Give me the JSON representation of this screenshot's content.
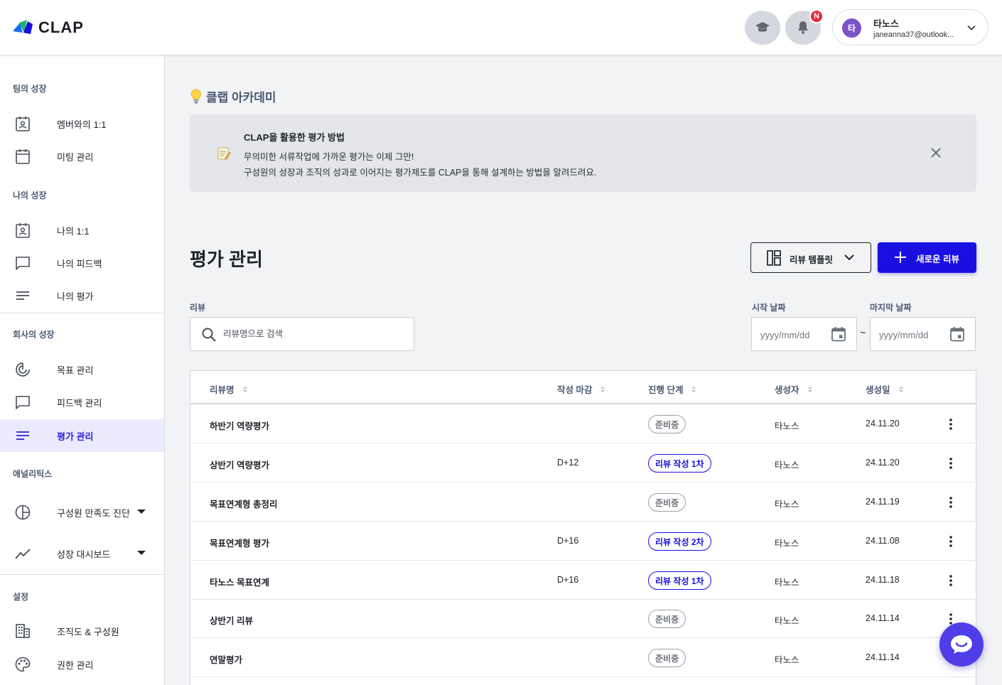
{
  "app": {
    "logo_text": "CLAP",
    "brand_color": "#1a0fe3"
  },
  "header": {
    "academy_icon": "graduation-cap-icon",
    "notification_badge": "N",
    "user": {
      "avatar_initial": "타",
      "name": "타노스",
      "email": "janeanna37@outlook..."
    }
  },
  "sidebar": {
    "sections": [
      {
        "title": "팀의 성장",
        "items": [
          {
            "label": "멤버와의 1:1",
            "icon": "contact-calendar-icon"
          },
          {
            "label": "미팅 관리",
            "icon": "calendar-icon"
          }
        ]
      },
      {
        "title": "나의 성장",
        "items": [
          {
            "label": "나의 1:1",
            "icon": "contact-calendar-icon"
          },
          {
            "label": "나의 피드백",
            "icon": "chat-bubble-icon"
          },
          {
            "label": "나의 평가",
            "icon": "lines-icon"
          }
        ]
      },
      {
        "title": "회사의 성장",
        "items": [
          {
            "label": "목표 관리",
            "icon": "target-icon"
          },
          {
            "label": "피드백 관리",
            "icon": "chat-bubble-icon"
          },
          {
            "label": "평가 관리",
            "icon": "lines-icon",
            "active": true
          }
        ]
      },
      {
        "title": "애널리틱스",
        "items": [
          {
            "label": "구성원 만족도 진단",
            "icon": "pie-chart-icon"
          },
          {
            "label": "성장 대시보드",
            "icon": "trend-line-icon"
          }
        ]
      },
      {
        "title": "설정",
        "items": [
          {
            "label": "조직도 & 구성원",
            "icon": "building-icon"
          },
          {
            "label": "권한 관리",
            "icon": "palette-icon"
          }
        ]
      }
    ]
  },
  "academy": {
    "title": "클랩 아카데미",
    "banner": {
      "title": "CLAP을 활용한 평가 방법",
      "line1": "무의미한 서류작업에 가까운 평가는 이제 그만!",
      "line2": "구성원의 성장과 조직의 성과로 이어지는 평가제도를 CLAP을 통해 설계하는 방법을 알려드려요."
    }
  },
  "main": {
    "title": "평가 관리",
    "template_button": "리뷰 템플릿",
    "new_button": "새로운 리뷰",
    "filters": {
      "review_label": "리뷰",
      "search_placeholder": "리뷰명으로 검색",
      "start_label": "시작 날짜",
      "end_label": "마지막 날짜",
      "date_placeholder": "yyyy/mm/dd",
      "separator": "~"
    },
    "table": {
      "headers": {
        "name": "리뷰명",
        "due": "작성 마감",
        "stage": "진행 단계",
        "creator": "생성자",
        "created": "생성일"
      },
      "rows": [
        {
          "name": "하반기 역량평가",
          "due": "",
          "stage": "준비중",
          "stage_type": "prep",
          "creator": "타노스",
          "created": "24.11.20"
        },
        {
          "name": "상반기 역량평가",
          "due": "D+12",
          "stage": "리뷰 작성 1차",
          "stage_type": "active",
          "creator": "타노스",
          "created": "24.11.20"
        },
        {
          "name": "목표연계형 총정리",
          "due": "",
          "stage": "준비중",
          "stage_type": "prep",
          "creator": "타노스",
          "created": "24.11.19"
        },
        {
          "name": "목표연계형 평가",
          "due": "D+16",
          "stage": "리뷰 작성 2차",
          "stage_type": "active",
          "creator": "타노스",
          "created": "24.11.08"
        },
        {
          "name": "타노스 목표연계",
          "due": "D+16",
          "stage": "리뷰 작성 1차",
          "stage_type": "active",
          "creator": "타노스",
          "created": "24.11.18"
        },
        {
          "name": "상반기 리뷰",
          "due": "",
          "stage": "준비중",
          "stage_type": "prep",
          "creator": "타노스",
          "created": "24.11.14"
        },
        {
          "name": "연말평가",
          "due": "",
          "stage": "준비중",
          "stage_type": "prep",
          "creator": "타노스",
          "created": "24.11.14"
        }
      ]
    }
  }
}
